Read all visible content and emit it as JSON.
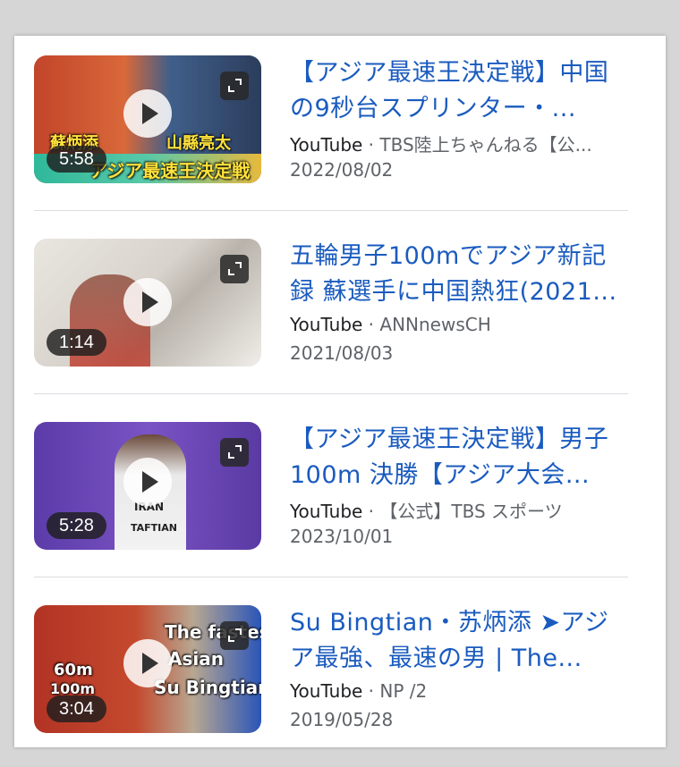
{
  "results": [
    {
      "title": "【アジア最速王決定戦】中国の9秒台スプリンター・...",
      "source": "YouTube",
      "channel": "TBS陸上ちゃんねる【公...",
      "date": "2022/08/02",
      "duration": "5:58",
      "thumb_texts": [
        "蘇炳添",
        "山縣亮太",
        "アジア最速王決定戦"
      ]
    },
    {
      "title": "五輪男子100mでアジア新記録 蘇選手に中国熱狂(2021...",
      "source": "YouTube",
      "channel": "ANNnewsCH",
      "date": "2021/08/03",
      "duration": "1:14",
      "thumb_texts": []
    },
    {
      "title": "【アジア最速王決定戦】男子100m 決勝【アジア大会...",
      "source": "YouTube",
      "channel": "【公式】TBS スポーツ",
      "date": "2023/10/01",
      "duration": "5:28",
      "thumb_texts": [
        "IRAN",
        "TAFTIAN"
      ]
    },
    {
      "title": "Su Bingtian・苏炳添 ➤アジア最強、最速の男 | The...",
      "source": "YouTube",
      "channel": "NP /2",
      "date": "2019/05/28",
      "duration": "3:04",
      "thumb_texts": [
        "The fastest",
        "Asian",
        "Su Bingtian",
        "60m",
        "100m"
      ]
    }
  ],
  "separator": " · ",
  "icons": {
    "play": "play-icon",
    "expand": "expand-icon"
  },
  "colors": {
    "title": "#1a5bbf",
    "meta": "#5f6368"
  }
}
